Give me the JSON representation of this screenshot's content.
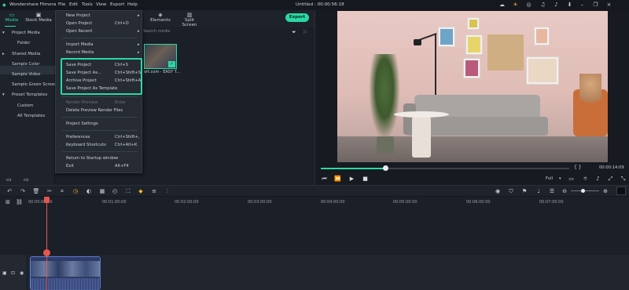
{
  "app": {
    "title": "Wondershare Filmora",
    "menu": [
      "File",
      "Edit",
      "Tools",
      "View",
      "Export",
      "Help"
    ],
    "project_title": "Untitled : 00:00:56:18"
  },
  "toolbar": {
    "tabs": [
      {
        "label": "Media",
        "icon": "folder-icon"
      },
      {
        "label": "Stock Media",
        "icon": "stock-media-icon"
      },
      {
        "label": "Elements",
        "icon": "elements-icon"
      },
      {
        "label": "Split Screen",
        "icon": "split-screen-icon"
      }
    ],
    "export_label": "Export"
  },
  "left_panel": {
    "items": [
      {
        "label": "Project Media",
        "expanded": true
      },
      {
        "label": "Folder",
        "selected": true
      },
      {
        "label": "Shared Media",
        "expanded": false
      },
      {
        "label": "Sample Color"
      },
      {
        "label": "Sample Video"
      },
      {
        "label": "Sample Green Screen"
      },
      {
        "label": "Preset Templates",
        "expanded": true
      },
      {
        "label": "Custom"
      },
      {
        "label": "All Templates"
      }
    ]
  },
  "media": {
    "search_placeholder": "Search media",
    "clip_name": "ort.com - EASY T..."
  },
  "file_menu": {
    "items": [
      {
        "label": "New Project",
        "shortcut": "",
        "submenu": true
      },
      {
        "label": "Open Project",
        "shortcut": "Ctrl+O"
      },
      {
        "label": "Open Recent",
        "shortcut": "",
        "submenu": true
      },
      {
        "label": "Import Media",
        "shortcut": "",
        "submenu": true
      },
      {
        "label": "Record Media",
        "shortcut": "",
        "submenu": true
      },
      {
        "label": "Save Project",
        "shortcut": "Ctrl+S"
      },
      {
        "label": "Save Project As...",
        "shortcut": "Ctrl+Shift+S"
      },
      {
        "label": "Archive Project",
        "shortcut": "Ctrl+Shift+A"
      },
      {
        "label": "Save Project As Template",
        "shortcut": ""
      },
      {
        "label": "Render Preview",
        "shortcut": "Enter",
        "disabled": true
      },
      {
        "label": "Delete Preview Render Files",
        "shortcut": ""
      },
      {
        "label": "Project Settings",
        "shortcut": ""
      },
      {
        "label": "Preferences",
        "shortcut": "Ctrl+Shift+,"
      },
      {
        "label": "Keyboard Shortcuts",
        "shortcut": "Ctrl+Alt+K"
      },
      {
        "label": "Return to Startup window",
        "shortcut": ""
      },
      {
        "label": "Exit",
        "shortcut": "Alt+F4"
      }
    ]
  },
  "preview": {
    "timecode": "00:00:14:09",
    "brackets": "{     }",
    "quality": "Full",
    "progress": 0.26
  },
  "timeline": {
    "ruler_labels": [
      "00:00:00:00",
      "00:01:00:00",
      "00:02:00:00",
      "00:03:00:00",
      "00:04:00:00",
      "00:05:00:00",
      "00:06:00:00",
      "00:07:00:00"
    ]
  },
  "colors": {
    "accent": "#2bd8a3",
    "playhead": "#e5574c",
    "clip": "#2d3b66"
  }
}
